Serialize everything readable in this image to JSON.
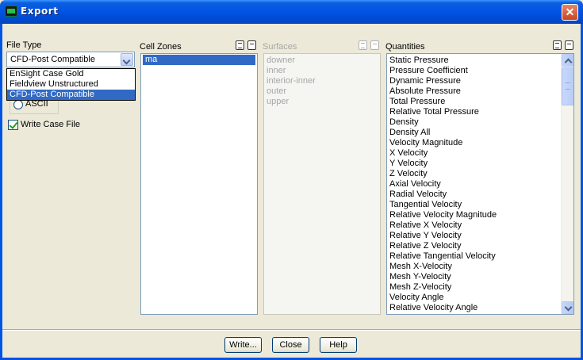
{
  "window": {
    "title": "Export"
  },
  "file_type": {
    "label": "File Type",
    "selected": "CFD-Post Compatible",
    "options": [
      "EnSight Case Gold",
      "Fieldview Unstructured",
      "CFD-Post Compatible"
    ]
  },
  "format": {
    "radio_ascii": "ASCII"
  },
  "write_case_file": {
    "label": "Write Case File",
    "checked": true
  },
  "cell_zones": {
    "label": "Cell Zones",
    "items": [
      "ma"
    ],
    "selected_index": 0
  },
  "surfaces": {
    "label": "Surfaces",
    "items": [
      "downer",
      "inner",
      "interior-inner",
      "outer",
      "upper"
    ]
  },
  "quantities": {
    "label": "Quantities",
    "items": [
      "Static Pressure",
      "Pressure Coefficient",
      "Dynamic Pressure",
      "Absolute Pressure",
      "Total Pressure",
      "Relative Total Pressure",
      "Density",
      "Density All",
      "Velocity Magnitude",
      "X Velocity",
      "Y Velocity",
      "Z Velocity",
      "Axial Velocity",
      "Radial Velocity",
      "Tangential Velocity",
      "Relative Velocity Magnitude",
      "Relative X Velocity",
      "Relative Y Velocity",
      "Relative Z Velocity",
      "Relative Tangential Velocity",
      "Mesh X-Velocity",
      "Mesh Y-Velocity",
      "Mesh Z-Velocity",
      "Velocity Angle",
      "Relative Velocity Angle"
    ]
  },
  "buttons": {
    "write": "Write...",
    "close": "Close",
    "help": "Help"
  },
  "colors": {
    "titlebar": "#0054e3",
    "selection": "#316ac5",
    "dialog_bg": "#ece9d8"
  }
}
